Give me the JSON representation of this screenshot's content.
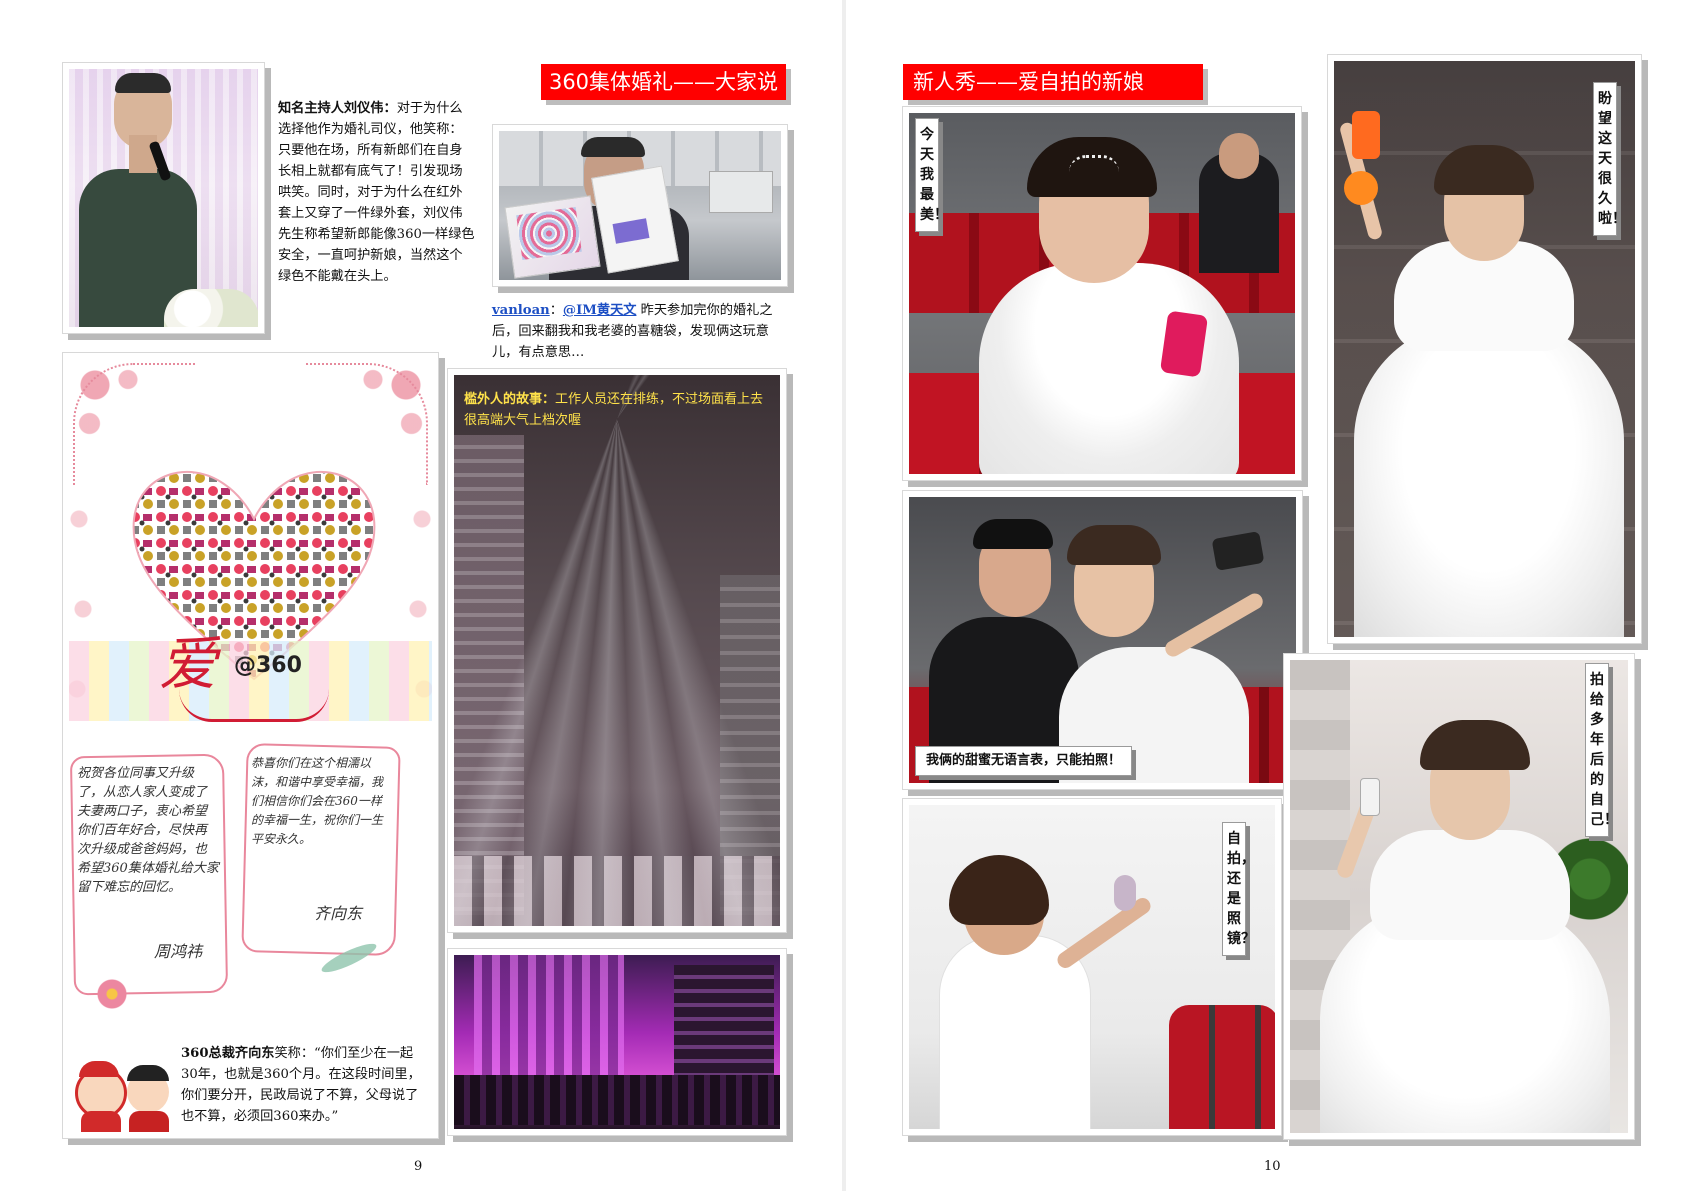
{
  "left": {
    "banner": "360集体婚礼——大家说",
    "host_quote": {
      "speaker": "知名主持人刘仪伟：",
      "text": "对于为什么选择他作为婚礼司仪，他笑称：只要他在场，所有新郎们在自身长相上就都有底气了！引发现场哄笑。同时，对于为什么在红外套上又穿了一件绿外套，刘仪伟先生称希望新郎能像360一样绿色安全，一直呵护新娘，当然这个绿色不能戴在头上。"
    },
    "weibo": {
      "user": "vanloan",
      "sep": "：",
      "mention": "@IM黄天文",
      "text": " 昨天参加完你的婚礼之后，回来翻我和我老婆的喜糖袋，发现俩这玩意儿，有点意思…"
    },
    "night_story": {
      "title": "槛外人的故事：",
      "text": "工作人员还在排练，不过场面看上去很高端大气上档次喔"
    },
    "card": {
      "ai_char": "爱",
      "brand": "@360",
      "note_left": "祝贺各位同事又升级了，从恋人家人变成了夫妻两口子，衷心希望你们百年好合，尽快再次升级成爸爸妈妈，也希望360集体婚礼给大家留下难忘的回忆。",
      "sign_left": "周鸿祎",
      "note_right": "恭喜你们在这个相濡以沫，和谐中享受幸福，我们相信你们会在360一样的幸福一生，祝你们一生平安永久。",
      "sign_right": "齐向东"
    },
    "ceo_quote": {
      "speaker": "360总裁齐向东",
      "text": "笑称：“你们至少在一起30年，也就是360个月。在这段时间里，你们要分开，民政局说了不算，父母说了也不算，必须回360来办。”"
    },
    "page_number": "9"
  },
  "right": {
    "banner": "新人秀——爱自拍的新娘",
    "caption_1": "今天我最美！",
    "caption_2": "盼望这天很久啦！",
    "caption_3": "我俩的甜蜜无语言表，只能拍照！",
    "caption_4": "自拍，还是照镜？",
    "caption_5": "拍给多年后的自己！",
    "page_number": "10"
  },
  "colors": {
    "banner_red": "#ff0000",
    "overlay_yellow": "#ffe24a",
    "link_blue": "#1d4fc4"
  }
}
